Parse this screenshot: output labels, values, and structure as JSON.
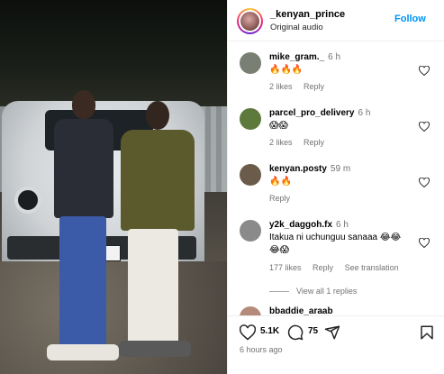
{
  "header": {
    "username": "_kenyan_prince",
    "subtitle": "Original audio",
    "follow_label": "Follow",
    "follow_color": "#0095f6"
  },
  "comments": [
    {
      "username": "mike_gram._",
      "time": "6 h",
      "text": "🔥🔥🔥",
      "likes": "2 likes",
      "reply": "Reply",
      "avatar_color": "#7a7f74"
    },
    {
      "username": "parcel_pro_delivery",
      "time": "6 h",
      "text": "😱😱",
      "likes": "2 likes",
      "reply": "Reply",
      "avatar_color": "#5d7a3c"
    },
    {
      "username": "kenyan.posty",
      "time": "59 m",
      "text": "🔥🔥",
      "reply": "Reply",
      "avatar_color": "#6b5b4a"
    },
    {
      "username": "y2k_daggoh.fx",
      "time": "6 h",
      "text": "Itakua ni uchunguu sanaaa 😂😂",
      "text2": "😂😱",
      "likes": "177 likes",
      "reply": "Reply",
      "see_translation": "See translation",
      "avatar_color": "#8a8a8a"
    }
  ],
  "view_replies": "View all 1 replies",
  "partial_comment_username": "bbaddie_araab",
  "actions": {
    "like_count": "5.1K",
    "comment_count": "75",
    "timestamp": "6 hours ago"
  },
  "icons": {
    "like": "heart-icon",
    "comment": "comment-icon",
    "share": "share-icon",
    "save": "bookmark-icon"
  }
}
